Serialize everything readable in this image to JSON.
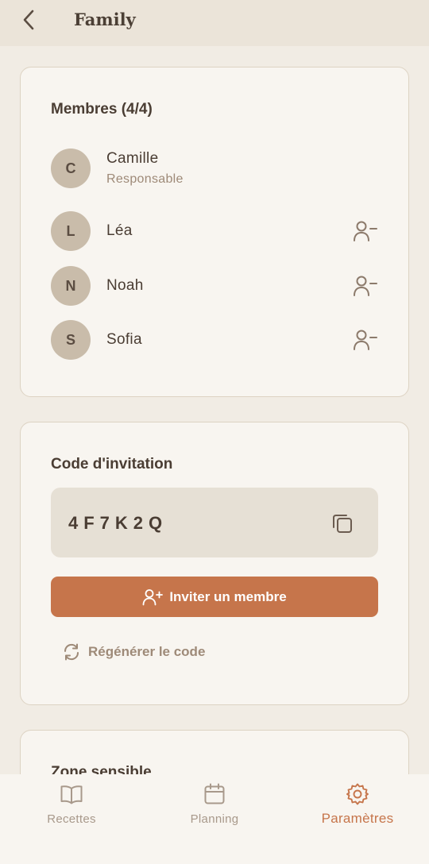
{
  "header": {
    "title": "Family"
  },
  "members": {
    "title": "Membres (4/4)",
    "list": [
      {
        "initial": "C",
        "name": "Camille",
        "role": "Responsable"
      },
      {
        "initial": "L",
        "name": "Léa"
      },
      {
        "initial": "N",
        "name": "Noah"
      },
      {
        "initial": "S",
        "name": "Sofia"
      }
    ]
  },
  "invitation": {
    "title": "Code d'invitation",
    "code": "4F7K2Q",
    "invite_label": "Inviter un membre",
    "regenerate_label": "Régénérer le code"
  },
  "danger": {
    "title": "Zone sensible"
  },
  "tabs": [
    {
      "label": "Recettes",
      "icon": "book-icon"
    },
    {
      "label": "Planning",
      "icon": "calendar-icon"
    },
    {
      "label": "Paramètres",
      "icon": "gear-icon",
      "active": true
    }
  ],
  "colors": {
    "accent": "#c6754b",
    "background": "#f1ece4",
    "card": "#f8f5f0",
    "avatar": "#c9bcaa",
    "muted": "#9e8a78"
  }
}
